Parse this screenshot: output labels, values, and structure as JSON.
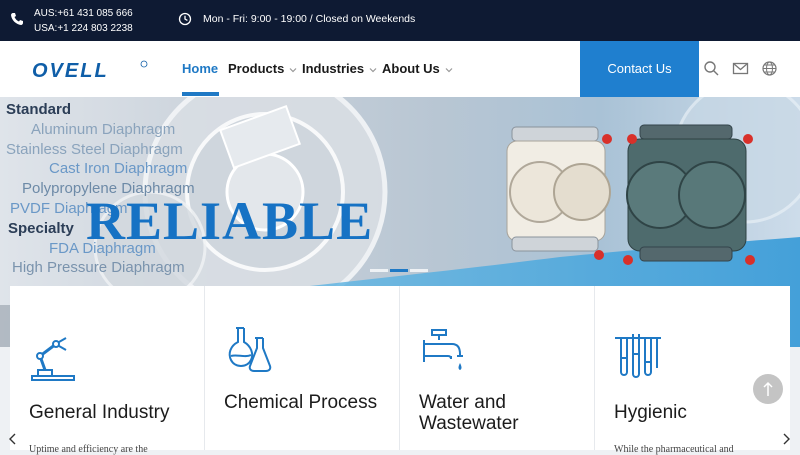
{
  "topbar": {
    "phone_aus": "AUS:+61 431 085 666",
    "phone_usa": "USA:+1 224 803 2238",
    "hours": "Mon - Fri: 9:00 - 19:00 / Closed on Weekends",
    "icons": [
      "phone-icon",
      "clock-icon"
    ]
  },
  "header": {
    "logo_text": "OVELL",
    "nav": [
      {
        "label": "Home",
        "active": true
      },
      {
        "label": "Products",
        "dropdown": true
      },
      {
        "label": "Industries",
        "dropdown": true
      },
      {
        "label": "About Us",
        "dropdown": true
      }
    ],
    "contact_label": "Contact Us",
    "icons": [
      "search-icon",
      "mail-icon",
      "globe-icon"
    ]
  },
  "hero": {
    "headline": "RELIABLE",
    "list": [
      {
        "text": "Standard",
        "style": "strong"
      },
      {
        "text": "Aluminum Diaphragm",
        "style": "lite"
      },
      {
        "text": "Stainless Steel Diaphragm",
        "style": "lite"
      },
      {
        "text": "Cast Iron Diaphragm",
        "style": "blue"
      },
      {
        "text": "Polypropylene Diaphragm",
        "style": "lite"
      },
      {
        "text": "PVDF Diaphragm",
        "style": "blue"
      },
      {
        "text": "Specialty",
        "style": "strong"
      },
      {
        "text": "FDA Diaphragm",
        "style": "blue"
      },
      {
        "text": "High Pressure Diaphragm",
        "style": "lite"
      }
    ],
    "slides": 3,
    "active_slide": 2
  },
  "industries": [
    {
      "title": "General Industry",
      "icon": "robot-arm-icon",
      "text": "Uptime and efficiency are the"
    },
    {
      "title": "Chemical Process",
      "icon": "flask-icon",
      "text": ""
    },
    {
      "title": "Water and Wastewater",
      "icon": "faucet-icon",
      "text": ""
    },
    {
      "title": "Hygienic",
      "icon": "test-tubes-icon",
      "text": "While the pharmaceutical and"
    }
  ],
  "colors": {
    "topbar_bg": "#0e1a33",
    "accent": "#1f79c5",
    "contact_bg": "#1f7fcf"
  }
}
